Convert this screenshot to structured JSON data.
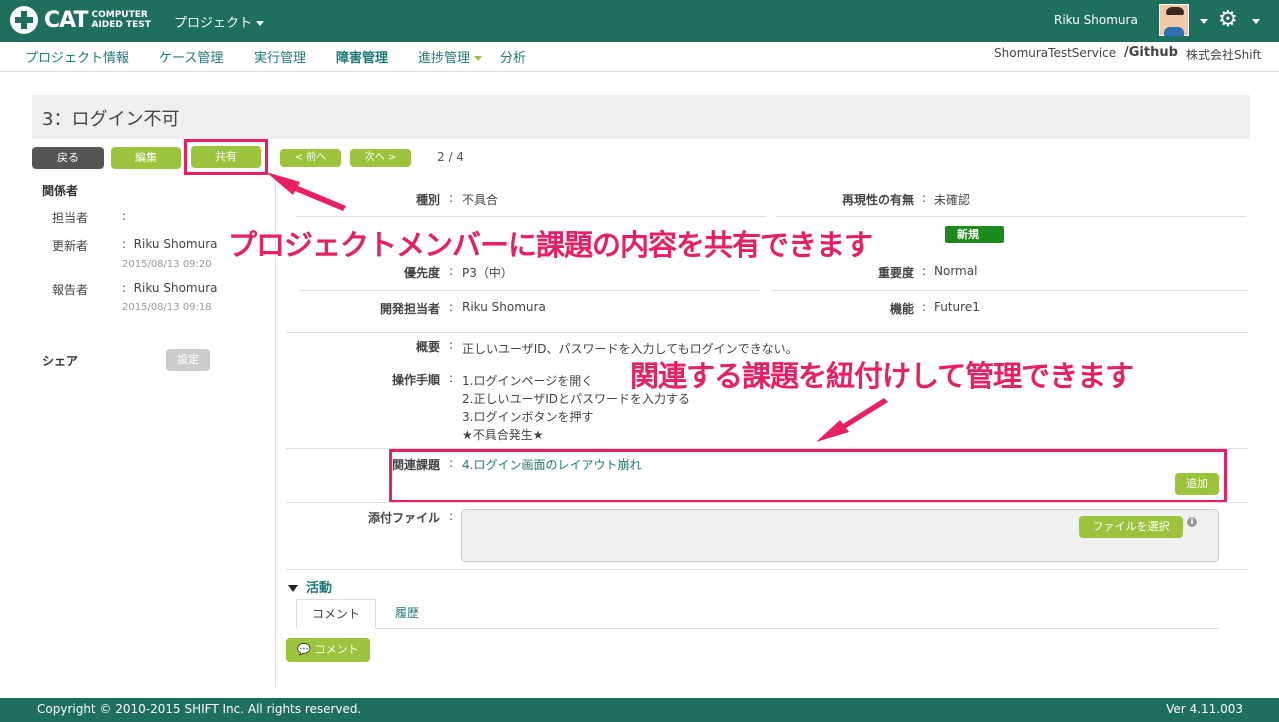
{
  "header": {
    "logo_main": "CAT",
    "logo_sub": "COMPUTER AIDED TEST",
    "project_menu": "プロジェクト",
    "user_name": "Riku Shomura"
  },
  "subnav": {
    "items": [
      "プロジェクト情報",
      "ケース管理",
      "実行管理",
      "障害管理",
      "進捗管理",
      "分析"
    ],
    "service": "ShomuraTestService",
    "repo": "/Github",
    "company": "株式会社Shift"
  },
  "issue": {
    "title": "3：ログイン不可"
  },
  "toolbar": {
    "back": "戻る",
    "edit": "編集",
    "share": "共有",
    "prev": "< 前へ",
    "next": "次へ >",
    "page": "2 / 4"
  },
  "sidebar": {
    "heading": "関係者",
    "assignee_label": "担当者",
    "assignee_value": "",
    "updater_label": "更新者",
    "updater_value": "Riku Shomura",
    "updater_time": "2015/08/13 09:20",
    "reporter_label": "報告者",
    "reporter_value": "Riku Shomura",
    "reporter_time": "2015/08/13 09:18",
    "share_label": "シェア",
    "share_button": "設定"
  },
  "fields": {
    "type_label": "種別",
    "type_value": "不具合",
    "repro_label": "再現性の有無",
    "repro_value": "未確認",
    "status_badge": "新規",
    "priority_label": "優先度",
    "priority_value": "P3（中）",
    "severity_label": "重要度",
    "severity_value": "Normal",
    "dev_label": "開発担当者",
    "dev_value": "Riku Shomura",
    "feature_label": "機能",
    "feature_value": "Future1",
    "summary_label": "概要",
    "summary_value": "正しいユーザID、パスワードを入力してもログインできない。",
    "steps_label": "操作手順",
    "steps": [
      "1.ログインページを開く",
      "2.正しいユーザIDとパスワードを入力する",
      "3.ログインボタンを押す",
      "★不具合発生★"
    ],
    "related_label": "関連課題",
    "related_value": "4.ログイン画面のレイアウト崩れ",
    "add_button": "追加",
    "attach_label": "添付ファイル",
    "file_button": "ファイルを選択"
  },
  "activity": {
    "heading": "活動",
    "tab_comment": "コメント",
    "tab_history": "履歴",
    "comment_button": "コメント"
  },
  "callouts": {
    "share_note": "プロジェクトメンバーに課題の内容を共有できます",
    "related_note": "関連する課題を紐付けして管理できます"
  },
  "footer": {
    "copyright": "Copyright © 2010-2015 SHIFT Inc. All rights reserved.",
    "version": "Ver 4.11.003"
  },
  "colors": {
    "brand": "#1e6f5c",
    "accent_green": "#9bc33c",
    "highlight": "#e91e63",
    "link": "#1e7b76"
  }
}
